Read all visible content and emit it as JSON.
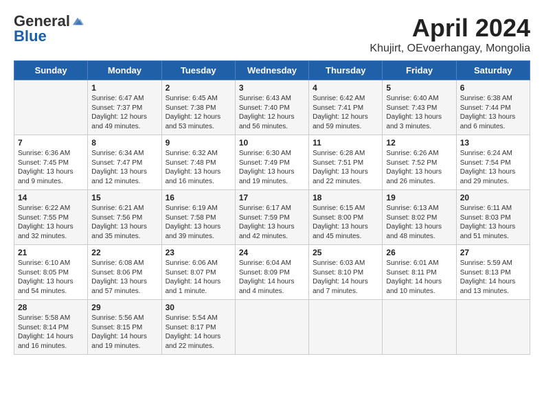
{
  "header": {
    "logo_general": "General",
    "logo_blue": "Blue",
    "title": "April 2024",
    "location": "Khujirt, OEvoerhangay, Mongolia"
  },
  "days_of_week": [
    "Sunday",
    "Monday",
    "Tuesday",
    "Wednesday",
    "Thursday",
    "Friday",
    "Saturday"
  ],
  "weeks": [
    [
      {
        "day": "",
        "info": ""
      },
      {
        "day": "1",
        "info": "Sunrise: 6:47 AM\nSunset: 7:37 PM\nDaylight: 12 hours\nand 49 minutes."
      },
      {
        "day": "2",
        "info": "Sunrise: 6:45 AM\nSunset: 7:38 PM\nDaylight: 12 hours\nand 53 minutes."
      },
      {
        "day": "3",
        "info": "Sunrise: 6:43 AM\nSunset: 7:40 PM\nDaylight: 12 hours\nand 56 minutes."
      },
      {
        "day": "4",
        "info": "Sunrise: 6:42 AM\nSunset: 7:41 PM\nDaylight: 12 hours\nand 59 minutes."
      },
      {
        "day": "5",
        "info": "Sunrise: 6:40 AM\nSunset: 7:43 PM\nDaylight: 13 hours\nand 3 minutes."
      },
      {
        "day": "6",
        "info": "Sunrise: 6:38 AM\nSunset: 7:44 PM\nDaylight: 13 hours\nand 6 minutes."
      }
    ],
    [
      {
        "day": "7",
        "info": "Sunrise: 6:36 AM\nSunset: 7:45 PM\nDaylight: 13 hours\nand 9 minutes."
      },
      {
        "day": "8",
        "info": "Sunrise: 6:34 AM\nSunset: 7:47 PM\nDaylight: 13 hours\nand 12 minutes."
      },
      {
        "day": "9",
        "info": "Sunrise: 6:32 AM\nSunset: 7:48 PM\nDaylight: 13 hours\nand 16 minutes."
      },
      {
        "day": "10",
        "info": "Sunrise: 6:30 AM\nSunset: 7:49 PM\nDaylight: 13 hours\nand 19 minutes."
      },
      {
        "day": "11",
        "info": "Sunrise: 6:28 AM\nSunset: 7:51 PM\nDaylight: 13 hours\nand 22 minutes."
      },
      {
        "day": "12",
        "info": "Sunrise: 6:26 AM\nSunset: 7:52 PM\nDaylight: 13 hours\nand 26 minutes."
      },
      {
        "day": "13",
        "info": "Sunrise: 6:24 AM\nSunset: 7:54 PM\nDaylight: 13 hours\nand 29 minutes."
      }
    ],
    [
      {
        "day": "14",
        "info": "Sunrise: 6:22 AM\nSunset: 7:55 PM\nDaylight: 13 hours\nand 32 minutes."
      },
      {
        "day": "15",
        "info": "Sunrise: 6:21 AM\nSunset: 7:56 PM\nDaylight: 13 hours\nand 35 minutes."
      },
      {
        "day": "16",
        "info": "Sunrise: 6:19 AM\nSunset: 7:58 PM\nDaylight: 13 hours\nand 39 minutes."
      },
      {
        "day": "17",
        "info": "Sunrise: 6:17 AM\nSunset: 7:59 PM\nDaylight: 13 hours\nand 42 minutes."
      },
      {
        "day": "18",
        "info": "Sunrise: 6:15 AM\nSunset: 8:00 PM\nDaylight: 13 hours\nand 45 minutes."
      },
      {
        "day": "19",
        "info": "Sunrise: 6:13 AM\nSunset: 8:02 PM\nDaylight: 13 hours\nand 48 minutes."
      },
      {
        "day": "20",
        "info": "Sunrise: 6:11 AM\nSunset: 8:03 PM\nDaylight: 13 hours\nand 51 minutes."
      }
    ],
    [
      {
        "day": "21",
        "info": "Sunrise: 6:10 AM\nSunset: 8:05 PM\nDaylight: 13 hours\nand 54 minutes."
      },
      {
        "day": "22",
        "info": "Sunrise: 6:08 AM\nSunset: 8:06 PM\nDaylight: 13 hours\nand 57 minutes."
      },
      {
        "day": "23",
        "info": "Sunrise: 6:06 AM\nSunset: 8:07 PM\nDaylight: 14 hours\nand 1 minute."
      },
      {
        "day": "24",
        "info": "Sunrise: 6:04 AM\nSunset: 8:09 PM\nDaylight: 14 hours\nand 4 minutes."
      },
      {
        "day": "25",
        "info": "Sunrise: 6:03 AM\nSunset: 8:10 PM\nDaylight: 14 hours\nand 7 minutes."
      },
      {
        "day": "26",
        "info": "Sunrise: 6:01 AM\nSunset: 8:11 PM\nDaylight: 14 hours\nand 10 minutes."
      },
      {
        "day": "27",
        "info": "Sunrise: 5:59 AM\nSunset: 8:13 PM\nDaylight: 14 hours\nand 13 minutes."
      }
    ],
    [
      {
        "day": "28",
        "info": "Sunrise: 5:58 AM\nSunset: 8:14 PM\nDaylight: 14 hours\nand 16 minutes."
      },
      {
        "day": "29",
        "info": "Sunrise: 5:56 AM\nSunset: 8:15 PM\nDaylight: 14 hours\nand 19 minutes."
      },
      {
        "day": "30",
        "info": "Sunrise: 5:54 AM\nSunset: 8:17 PM\nDaylight: 14 hours\nand 22 minutes."
      },
      {
        "day": "",
        "info": ""
      },
      {
        "day": "",
        "info": ""
      },
      {
        "day": "",
        "info": ""
      },
      {
        "day": "",
        "info": ""
      }
    ]
  ]
}
